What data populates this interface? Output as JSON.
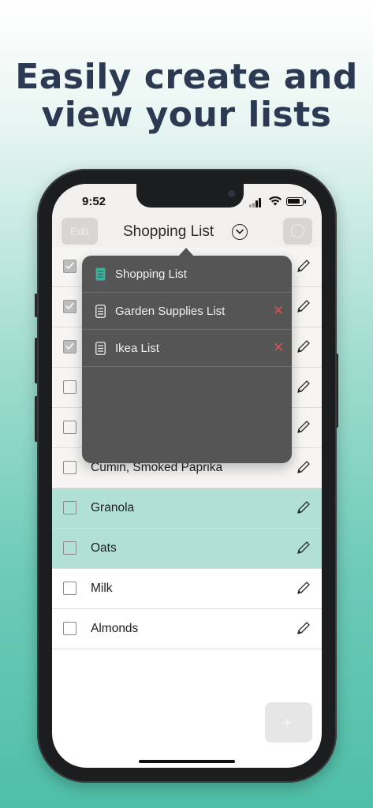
{
  "headline": {
    "line1": "Easily create and",
    "line2": "view your lists"
  },
  "status_bar": {
    "time": "9:52"
  },
  "nav": {
    "edit_label": "Edit",
    "title": "Shopping List"
  },
  "items": [
    {
      "label": "",
      "checked": true
    },
    {
      "label": "",
      "checked": true
    },
    {
      "label": "",
      "checked": true
    },
    {
      "label": "",
      "checked": false
    },
    {
      "label": "",
      "checked": false
    },
    {
      "label": "Cumin, Smoked Paprika",
      "checked": false
    },
    {
      "label": "Granola",
      "checked": false
    },
    {
      "label": "Oats",
      "checked": false
    },
    {
      "label": "Milk",
      "checked": false
    },
    {
      "label": "Almonds",
      "checked": false
    }
  ],
  "popover": {
    "lists": [
      {
        "name": "Shopping List",
        "active": true,
        "deletable": false
      },
      {
        "name": "Garden Supplies List",
        "active": false,
        "deletable": true
      },
      {
        "name": "Ikea List",
        "active": false,
        "deletable": true
      }
    ]
  },
  "fab": {
    "label": "+"
  },
  "colors": {
    "headline": "#2b3a52",
    "accent_teal": "#3fae9a",
    "highlight_row": "#b1e0d7",
    "popover_bg": "#555555",
    "delete_red": "#d9534f"
  }
}
